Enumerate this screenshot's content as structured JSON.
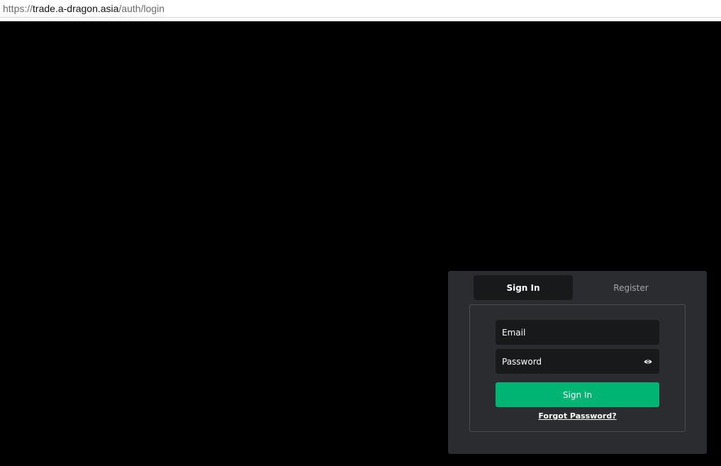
{
  "browser": {
    "url_scheme": "https://",
    "url_host": "trade.a-dragon.asia",
    "url_path": "/auth/login"
  },
  "auth": {
    "tabs": {
      "signin_label": "Sign In",
      "register_label": "Register"
    },
    "email_placeholder": "Email",
    "password_placeholder": "Password",
    "submit_label": "Sign In",
    "forgot_label": "Forgot Password?",
    "icons": {
      "password_toggle": "eye-icon"
    }
  },
  "colors": {
    "page_background": "#000000",
    "panel_background": "#2b2c30",
    "input_background": "#18191b",
    "primary_button": "#00b574"
  }
}
